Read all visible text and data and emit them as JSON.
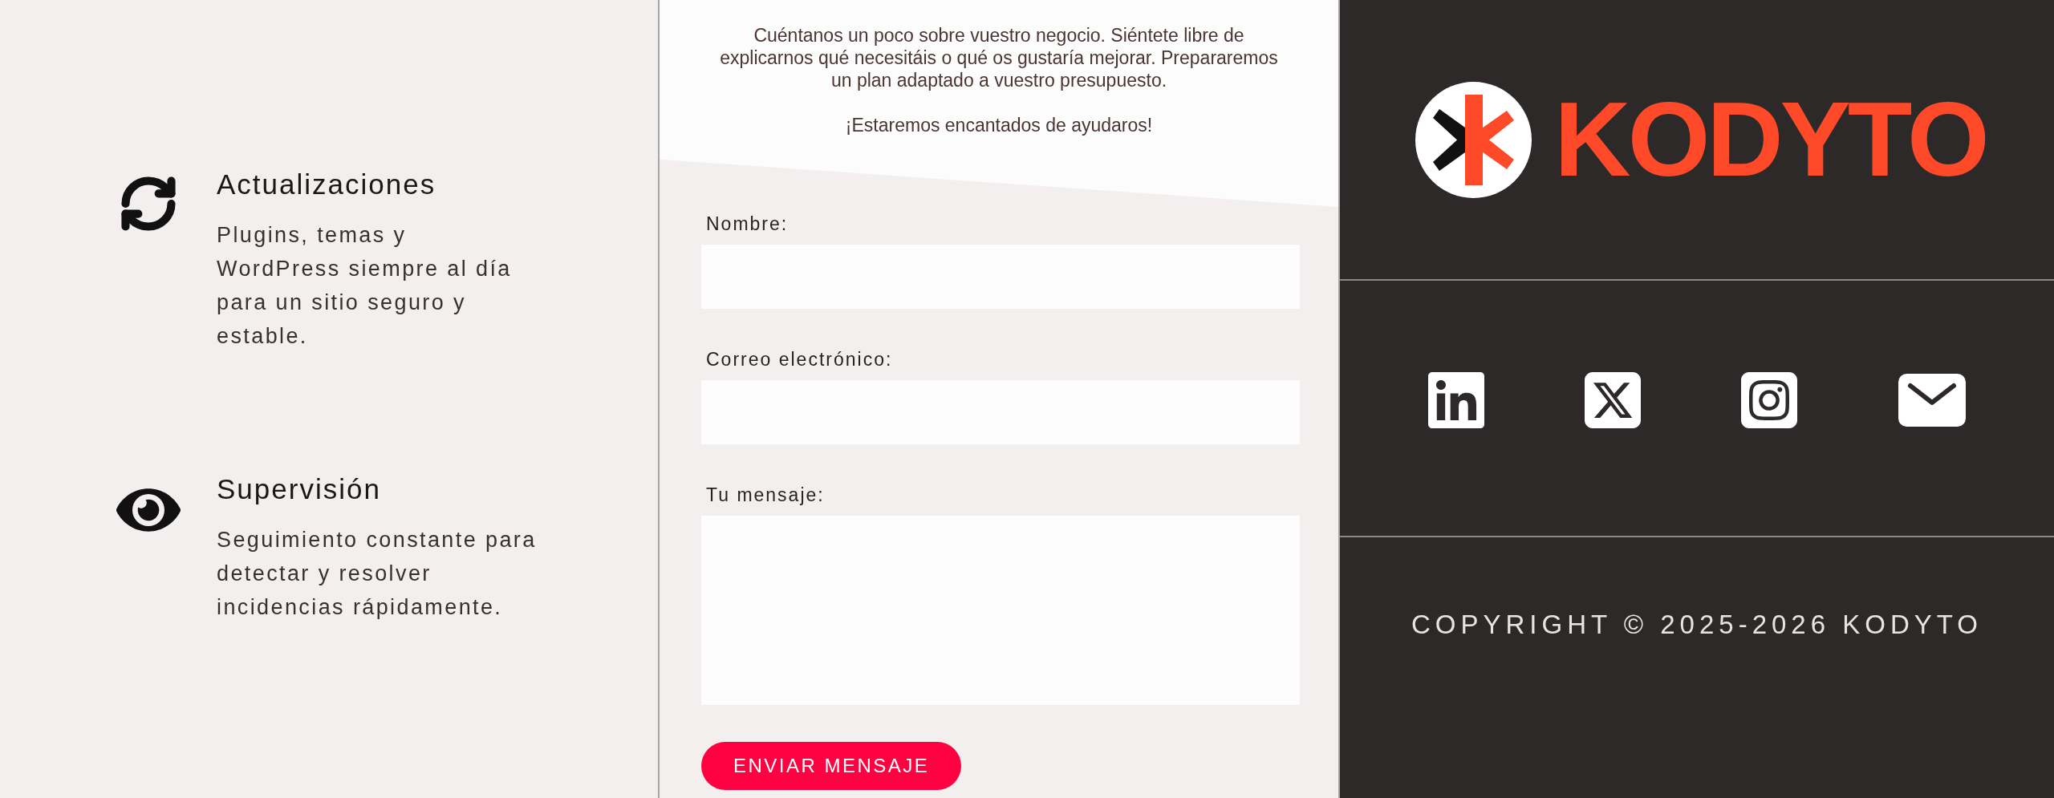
{
  "features": [
    {
      "kind": "refresh",
      "title": "Actualizaciones",
      "description": "Plugins, temas y WordPress siempre al día para un sitio seguro y estable."
    },
    {
      "kind": "eye",
      "title": "Supervisión",
      "description": "Seguimiento constante para detectar y resolver incidencias rápidamente."
    }
  ],
  "intro": [
    "Cuéntanos un poco sobre vuestro negocio. Siéntete libre de explicarnos qué necesitáis o qué os gustaría mejorar. Prepararemos un plan adaptado a vuestro presupuesto.",
    "¡Estaremos encantados de ayudaros!"
  ],
  "form": {
    "fields": [
      {
        "kind": "text",
        "label": "Nombre:"
      },
      {
        "kind": "email",
        "label": "Correo electrónico:"
      },
      {
        "kind": "textarea",
        "label": "Tu mensaje:"
      }
    ],
    "submit": "ENVIAR MENSAJE"
  },
  "logo": {
    "text": "KODYTO"
  },
  "social": [
    {
      "kind": "linkedin"
    },
    {
      "kind": "x"
    },
    {
      "kind": "instagram"
    },
    {
      "kind": "email"
    }
  ],
  "copyright": "COPYRIGHT © 2025-2026 KODYTO"
}
